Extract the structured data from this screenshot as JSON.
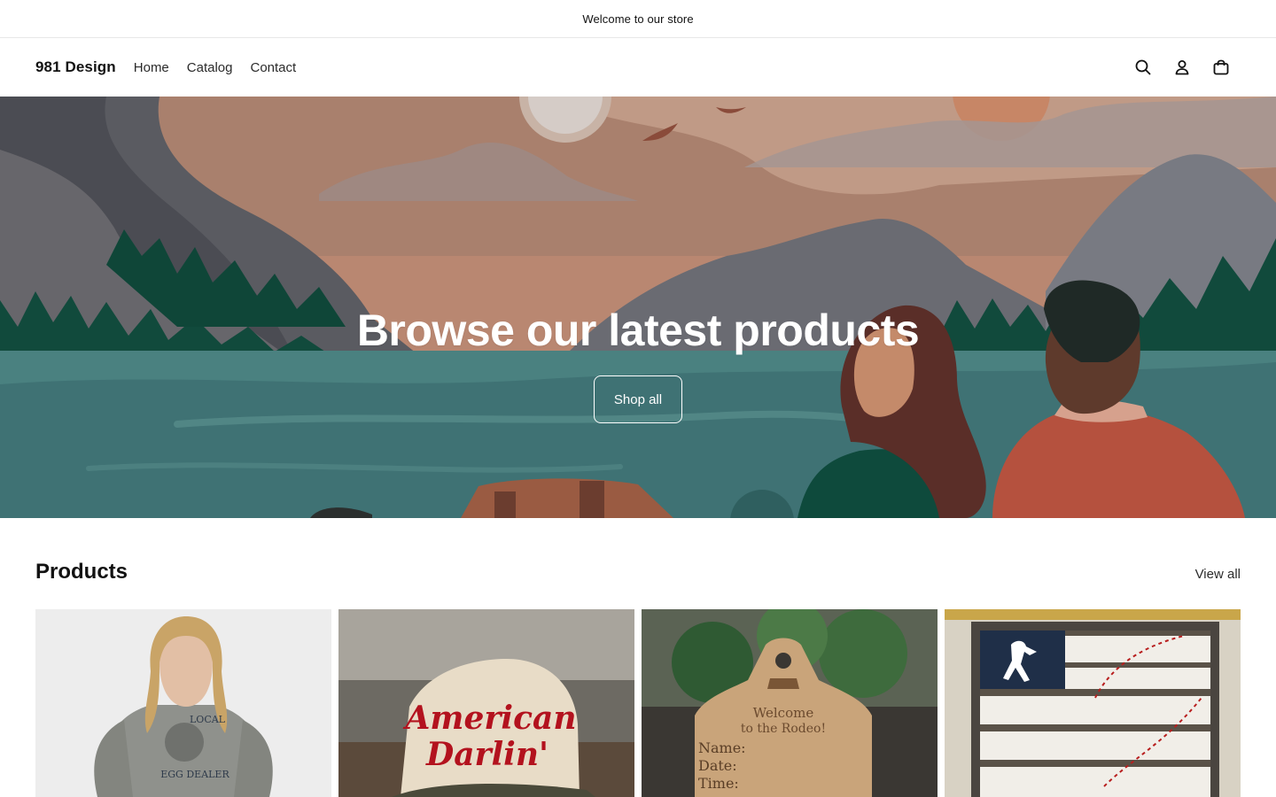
{
  "announcement": {
    "text": "Welcome to our store"
  },
  "header": {
    "logo": "981 Design",
    "nav": [
      "Home",
      "Catalog",
      "Contact"
    ],
    "icons": [
      "search-icon",
      "account-icon",
      "cart-icon"
    ]
  },
  "hero": {
    "title": "Browse our latest products",
    "button_label": "Shop all"
  },
  "products": {
    "title": "Products",
    "view_all_label": "View all",
    "items": [
      {
        "image_text_1": "LOCAL",
        "image_text_2": "EGG DEALER"
      },
      {
        "image_text_1": "American",
        "image_text_2": "Darlin'"
      },
      {
        "image_text_1": "Welcome",
        "image_text_2": "to the Rodeo!",
        "image_text_3": "Name:",
        "image_text_4": "Date:",
        "image_text_5": "Time:"
      },
      {
        "image_text_1": ""
      }
    ]
  },
  "colors": {
    "hero_water": "#3f7274",
    "hero_sky": "#b98771",
    "trees": "#114a3c",
    "text_dark": "#121212"
  }
}
